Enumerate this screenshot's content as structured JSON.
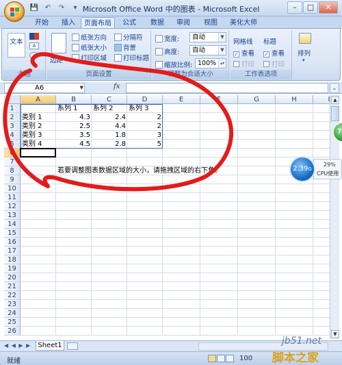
{
  "window": {
    "title": "Microsoft Office Word 中的图表 - Microsoft Excel",
    "controls": [
      "–",
      "□",
      "✕"
    ]
  },
  "qat": [
    "💾",
    "↶",
    "↷",
    "▾"
  ],
  "tabs": [
    "开始",
    "插入",
    "页面布局",
    "公式",
    "数据",
    "审阅",
    "视图",
    "美化大师"
  ],
  "active_tab": "页面布局",
  "ribbon": {
    "theme": {
      "label": "主题",
      "big_btn": "文本"
    },
    "page_setup": {
      "label": "页面设置",
      "margins": "边距",
      "orientation": "纸张方向",
      "size": "纸张大小",
      "print_area": "打印区域",
      "breaks": "分隔符",
      "background": "背景",
      "print_titles": "打印标题"
    },
    "scale": {
      "label": "调整为合适大小",
      "width_label": "宽度:",
      "width_value": "自动",
      "height_label": "高度:",
      "height_value": "自动",
      "scale_label": "缩放比例:",
      "scale_value": "100%"
    },
    "sheet_options": {
      "label": "工作表选项",
      "gridlines": "网格线",
      "headings": "标题",
      "view": "查看",
      "print": "打印",
      "check": "✓"
    },
    "arrange": {
      "label": "排列"
    }
  },
  "formula_bar": {
    "name_box": "A6",
    "fx": "fx",
    "formula": ""
  },
  "grid": {
    "columns": [
      "A",
      "B",
      "C",
      "D",
      "E",
      "F",
      "G",
      "H",
      "I"
    ],
    "rows": [
      "1",
      "2",
      "3",
      "4",
      "5",
      "6",
      "7",
      "8",
      "9",
      "10",
      "11",
      "12",
      "13",
      "14",
      "15",
      "16",
      "17",
      "18",
      "19",
      "20",
      "21",
      "22",
      "23",
      "24",
      "25",
      "26"
    ],
    "selected_row": "6",
    "selected_col": "A",
    "headers": [
      "系列 1",
      "系列 2",
      "系列 3"
    ],
    "data": [
      {
        "category": "类别 1",
        "s1": "4.3",
        "s2": "2.4",
        "s3": "2"
      },
      {
        "category": "类别 2",
        "s1": "2.5",
        "s2": "4.4",
        "s3": "2"
      },
      {
        "category": "类别 3",
        "s1": "3.5",
        "s2": "1.8",
        "s3": "3"
      },
      {
        "category": "类别 4",
        "s1": "4.5",
        "s2": "2.8",
        "s3": "5"
      }
    ],
    "note": "若要调整图表数据区域的大小，请拖拽区域的右下角。"
  },
  "sheet_tabs": {
    "nav": "◀ ◀ ▶ ▶",
    "sheet": "Sheet1"
  },
  "status": {
    "text": "就绪",
    "zoom": "100"
  },
  "cpu_widget": {
    "speed": "2.39",
    "unit": "G",
    "percent": "29%",
    "label": "CPU使用",
    "green": "72"
  },
  "watermark": {
    "line1": "jb51.net",
    "line2": "脚本之家"
  },
  "colors": {
    "annotation": "#e41b1b",
    "selection": "#3a5fcd",
    "ribbon": "#dbe6f5"
  }
}
